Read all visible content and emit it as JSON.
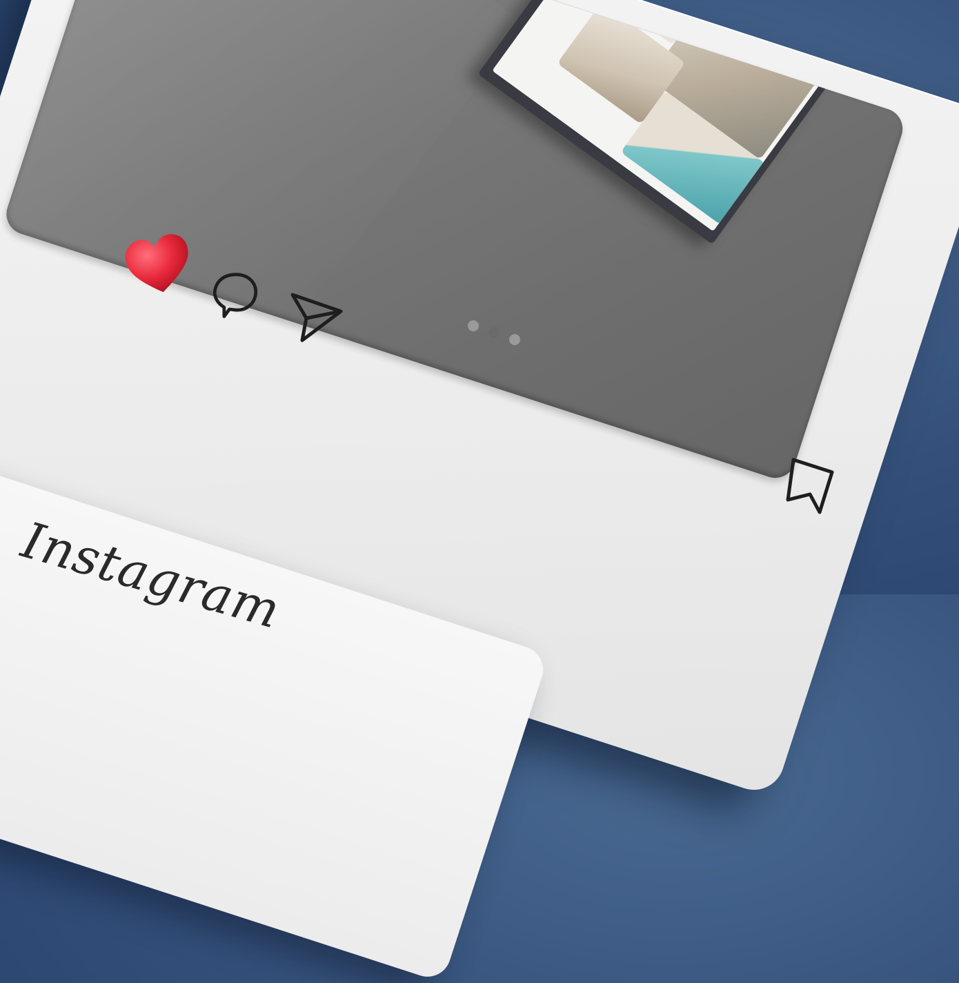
{
  "brand": {
    "name": "Instagram"
  },
  "post": {
    "image_description_icons": [
      "brochure",
      "garden-photo",
      "interior-photo",
      "lounge-photo",
      "pool-photo"
    ],
    "liked": true,
    "carousel": {
      "total": 3,
      "active": 2
    }
  },
  "icons": {
    "like": "heart-icon",
    "comment": "comment-icon",
    "share": "send-icon",
    "save": "bookmark-icon"
  },
  "colors": {
    "background": "#34507a",
    "card": "#f0f0f0",
    "heart": "#e8283a",
    "icon_stroke": "#1e1e1e",
    "image_gray": "#7a7a7a"
  }
}
